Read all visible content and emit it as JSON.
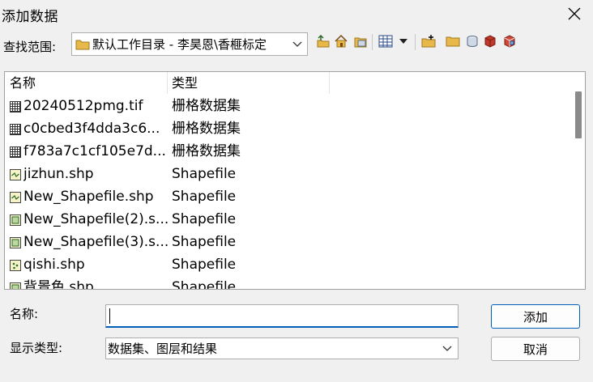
{
  "window": {
    "title": "添加数据"
  },
  "look_in": {
    "label": "查找范围:",
    "value": "默认工作目录 - 李昊恩\\香榧标定"
  },
  "list": {
    "columns": [
      "名称",
      "类型"
    ],
    "rows": [
      {
        "name": "20240512pmg.tif",
        "type": "栅格数据集",
        "icon": "raster-icon"
      },
      {
        "name": "c0cbed3f4dda3c6...",
        "type": "栅格数据集",
        "icon": "raster-icon"
      },
      {
        "name": "f783a7c1cf105e7d...",
        "type": "栅格数据集",
        "icon": "raster-icon"
      },
      {
        "name": "jizhun.shp",
        "type": "Shapefile",
        "icon": "polyline-shapefile-icon"
      },
      {
        "name": "New_Shapefile.shp",
        "type": "Shapefile",
        "icon": "polyline-shapefile-icon"
      },
      {
        "name": "New_Shapefile(2).s...",
        "type": "Shapefile",
        "icon": "polygon-shapefile-icon"
      },
      {
        "name": "New_Shapefile(3).s...",
        "type": "Shapefile",
        "icon": "polygon-shapefile-icon"
      },
      {
        "name": "qishi.shp",
        "type": "Shapefile",
        "icon": "point-shapefile-icon"
      },
      {
        "name": "背景色.shp",
        "type": "Shapefile",
        "icon": "polygon-shapefile-icon"
      }
    ]
  },
  "name_field": {
    "label": "名称:",
    "value": ""
  },
  "type_field": {
    "label": "显示类型:",
    "value": "数据集、图层和结果"
  },
  "buttons": {
    "add": "添加",
    "cancel": "取消"
  },
  "colors": {
    "accent": "#005fb8",
    "folder": "#e8b84a",
    "icon_red": "#c0392b"
  }
}
